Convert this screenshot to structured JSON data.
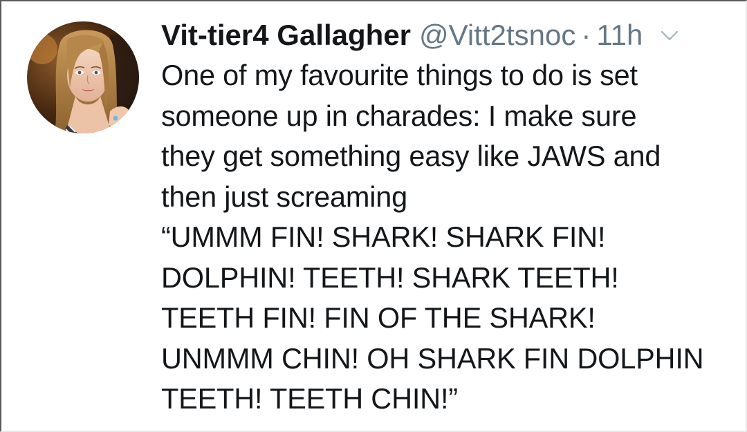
{
  "tweet": {
    "author": {
      "display_name": "Vit-tier4 Gallagher",
      "handle": "@Vitt2tsnoc"
    },
    "separator": "·",
    "timestamp": "11h",
    "menu_icon": "chevron-down-icon",
    "avatar_icon": "avatar-photo",
    "text": "One of my favourite things to do is set\nsomeone up in charades: I make sure\nthey get something easy like JAWS and\nthen just screaming\n“UMMM FIN! SHARK! SHARK FIN!\nDOLPHIN! TEETH! SHARK TEETH!\nTEETH FIN! FIN OF THE SHARK!\nUNMMM CHIN! OH SHARK FIN DOLPHIN\nTEETH! TEETH CHIN!”"
  },
  "colors": {
    "text_primary": "#14171a",
    "text_secondary": "#657786",
    "background": "#ffffff"
  }
}
